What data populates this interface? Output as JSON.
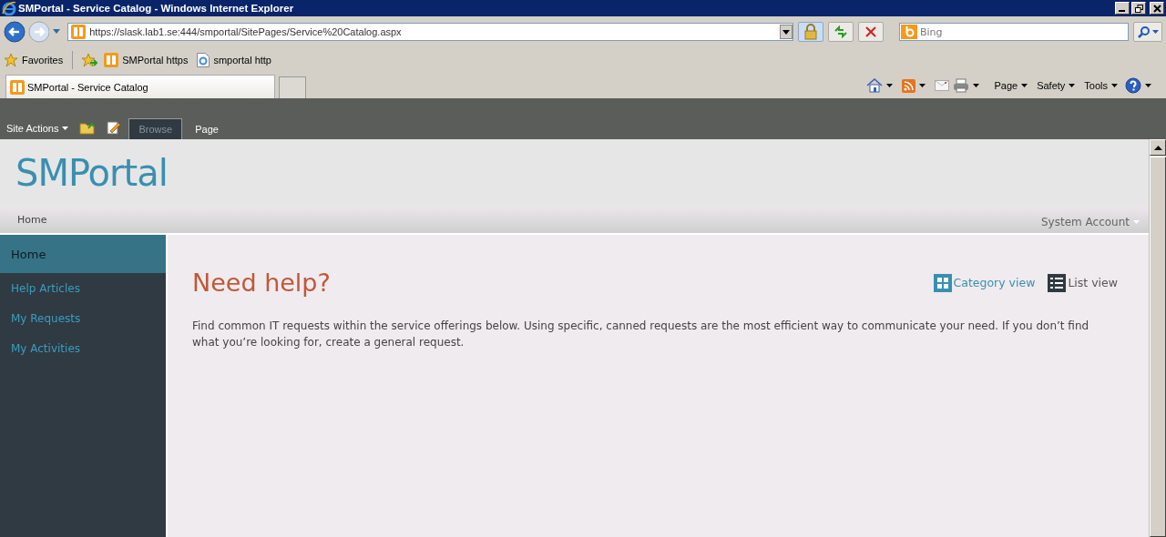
{
  "window": {
    "title": "SMPortal - Service Catalog - Windows Internet Explorer"
  },
  "address_bar": {
    "value": "https://slask.lab1.se:444/smportal/SitePages/Service%20Catalog.aspx"
  },
  "search": {
    "placeholder": "Bing"
  },
  "favorites_bar": {
    "favorites_label": "Favorites",
    "links": [
      {
        "label": "SMPortal https",
        "kind": "portal"
      },
      {
        "label": "smportal http",
        "kind": "page"
      }
    ]
  },
  "browser_tabs": [
    {
      "label": "SMPortal - Service Catalog",
      "selected": true
    }
  ],
  "command_bar": {
    "menus": [
      "Page",
      "Safety",
      "Tools"
    ]
  },
  "ribbon": {
    "site_actions": "Site Actions",
    "tabs": [
      {
        "label": "Browse",
        "selected": true
      },
      {
        "label": "Page",
        "selected": false
      }
    ]
  },
  "site": {
    "title": "SMPortal",
    "top_nav": "Home",
    "user": "System Account"
  },
  "sidebar": {
    "items": [
      {
        "label": "Home",
        "selected": true
      },
      {
        "label": "Help Articles",
        "selected": false
      },
      {
        "label": "My Requests",
        "selected": false
      },
      {
        "label": "My Activities",
        "selected": false
      }
    ]
  },
  "content": {
    "heading": "Need help?",
    "views": [
      {
        "label": "Category view",
        "kind": "grid",
        "selected": true
      },
      {
        "label": "List view",
        "kind": "list",
        "selected": false
      }
    ],
    "text": "Find common IT requests within the service offerings below.  Using specific, canned requests are the most efficient way to communicate your need. If you don’t find what you’re looking for, create a general request."
  }
}
